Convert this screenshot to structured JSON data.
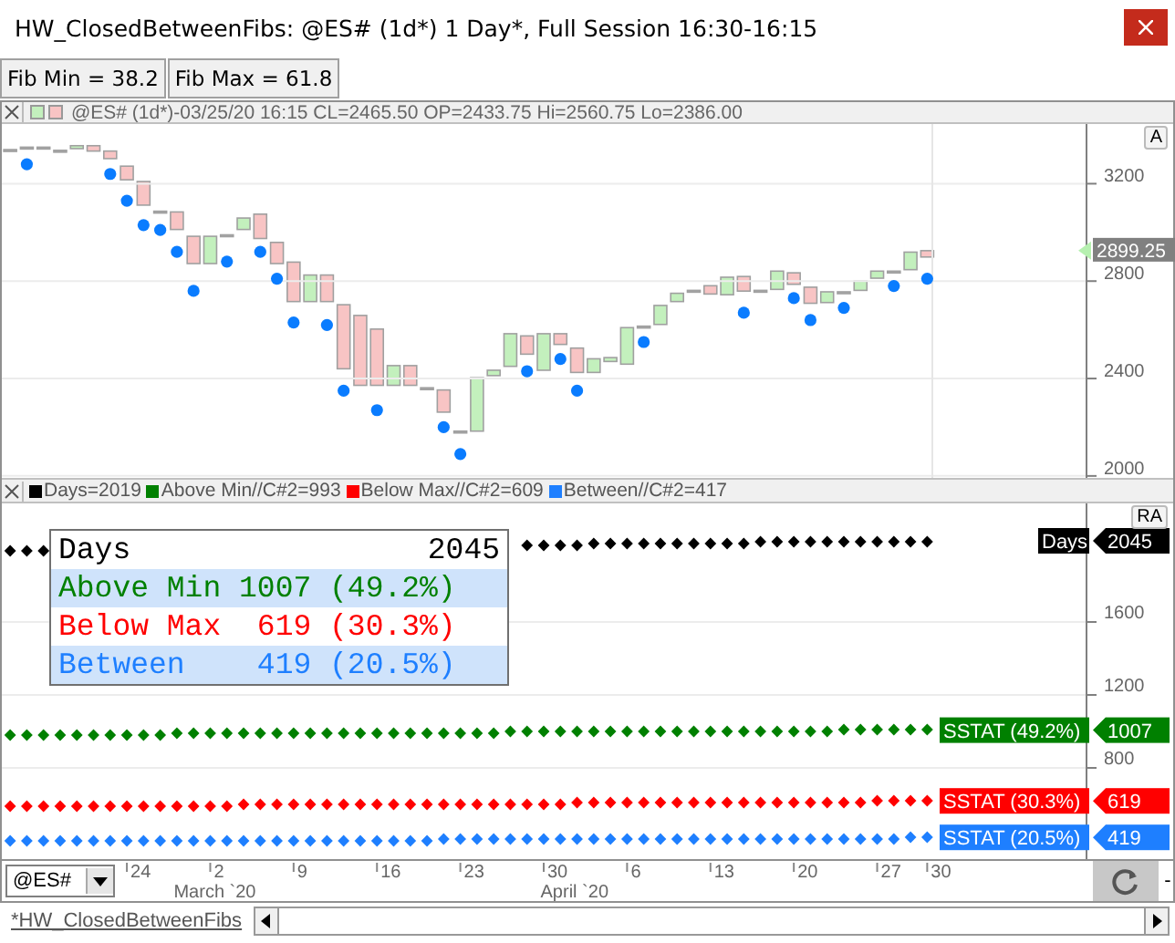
{
  "window": {
    "title": "HW_ClosedBetweenFibs: @ES# (1d*) 1 Day*, Full Session 16:30-16:15"
  },
  "inputs": [
    {
      "label": "Fib Min = 38.2"
    },
    {
      "label": "Fib Max = 61.8"
    }
  ],
  "price_pane": {
    "legend": "@ES# (1d*)-03/25/20 16:15 CL=2465.50 OP=2433.75 Hi=2560.75 Lo=2386.00",
    "scale_button": "A",
    "last_price": "2899.25",
    "chart_data": {
      "type": "scatter",
      "grid": true,
      "yticks": [
        2000,
        2400,
        2800,
        3200
      ],
      "ylim": [
        1992,
        3445
      ],
      "series": [
        {
          "color": "#0a7cff",
          "values": [
            null,
            3280,
            null,
            null,
            null,
            null,
            3240,
            3130,
            3030,
            3010,
            2920,
            2760,
            null,
            2880,
            null,
            2920,
            2810,
            2630,
            null,
            2620,
            2350,
            null,
            2270,
            null,
            null,
            null,
            2200,
            2090,
            null,
            null,
            null,
            2430,
            null,
            2480,
            2350,
            null,
            null,
            null,
            2550,
            null,
            null,
            null,
            null,
            null,
            2670,
            null,
            null,
            2730,
            2640,
            null,
            2690,
            null,
            null,
            2780,
            null,
            2810,
            null,
            null,
            null,
            null,
            null,
            null,
            null,
            null,
            null
          ]
        }
      ]
    }
  },
  "stats_pane": {
    "scale_button": "RA",
    "legend": [
      {
        "label": "Days=2019",
        "color": "#000000"
      },
      {
        "label": "Above Min//C#2=993",
        "color": "#008000"
      },
      {
        "label": "Below Max//C#2=609",
        "color": "#ff0000"
      },
      {
        "label": "Between//C#2=417",
        "color": "#1e7fff"
      }
    ],
    "table": [
      {
        "label": "Days",
        "value": "2045",
        "color": "#000000",
        "selected": false
      },
      {
        "label": "Above Min 1007 (49.2%)",
        "color": "#008000",
        "selected": true
      },
      {
        "label": "Below Max  619 (30.3%)",
        "color": "#ff0000",
        "selected": false
      },
      {
        "label": "Between    419 (20.5%)",
        "color": "#1e7fff",
        "selected": true
      }
    ],
    "value_tags": [
      {
        "label": "Days",
        "value": "2045",
        "color": "#000000"
      },
      {
        "label": "SSTAT (49.2%)",
        "value": "1007",
        "color": "#008000"
      },
      {
        "label": "SSTAT (30.3%)",
        "value": "619",
        "color": "#ff0000"
      },
      {
        "label": "SSTAT (20.5%)",
        "value": "419",
        "color": "#1e7fff"
      }
    ],
    "chart_data": {
      "type": "scatter",
      "grid": true,
      "yticks": [
        800,
        1200,
        1600
      ],
      "ylim": [
        300,
        2250
      ],
      "series": [
        {
          "color": "#000000",
          "values": [
            1990,
            1990,
            1990,
            null,
            null,
            null,
            null,
            null,
            null,
            null,
            null,
            null,
            null,
            null,
            null,
            null,
            null,
            null,
            null,
            null,
            null,
            null,
            null,
            null,
            null,
            null,
            null,
            null,
            null,
            null,
            null,
            2020,
            2020,
            2020,
            2020,
            2030,
            2030,
            2030,
            2030,
            2030,
            2030,
            2030,
            2030,
            2030,
            2030,
            2040,
            2040,
            2040,
            2040,
            2040,
            2040,
            2040,
            2040,
            2040,
            2040,
            2040,
            null,
            null,
            null,
            null,
            null,
            null,
            null,
            null,
            null
          ]
        },
        {
          "color": "#008000",
          "values": [
            980,
            980,
            980,
            980,
            980,
            980,
            980,
            980,
            980,
            980,
            990,
            990,
            990,
            990,
            990,
            990,
            990,
            990,
            990,
            990,
            990,
            990,
            990,
            990,
            990,
            990,
            990,
            990,
            990,
            990,
            1000,
            1000,
            1000,
            1000,
            1000,
            1000,
            1000,
            1000,
            1000,
            1000,
            1000,
            1000,
            1000,
            1000,
            1000,
            1000,
            1000,
            1000,
            1000,
            1000,
            1010,
            1010,
            1010,
            1010,
            1010,
            1010,
            null,
            null,
            null,
            null,
            null,
            null,
            null,
            null,
            null
          ]
        },
        {
          "color": "#ff0000",
          "values": [
            590,
            590,
            590,
            590,
            590,
            590,
            590,
            590,
            590,
            590,
            590,
            590,
            590,
            590,
            600,
            600,
            600,
            600,
            600,
            600,
            600,
            600,
            600,
            600,
            600,
            600,
            600,
            600,
            600,
            600,
            600,
            600,
            600,
            600,
            610,
            610,
            610,
            610,
            610,
            610,
            610,
            610,
            610,
            610,
            610,
            610,
            610,
            610,
            610,
            610,
            610,
            610,
            620,
            620,
            620,
            620,
            null,
            null,
            null,
            null,
            null,
            null,
            null,
            null,
            null
          ]
        },
        {
          "color": "#1e7fff",
          "values": [
            400,
            400,
            400,
            400,
            400,
            400,
            400,
            400,
            400,
            400,
            400,
            400,
            400,
            400,
            400,
            400,
            400,
            400,
            400,
            400,
            400,
            400,
            400,
            400,
            400,
            400,
            410,
            410,
            410,
            410,
            410,
            410,
            410,
            410,
            410,
            410,
            410,
            410,
            410,
            410,
            410,
            410,
            410,
            410,
            410,
            410,
            410,
            410,
            410,
            410,
            410,
            410,
            410,
            410,
            420,
            420,
            null,
            null,
            null,
            null,
            null,
            null,
            null,
            null,
            null
          ]
        }
      ]
    }
  },
  "date_axis": {
    "days": [
      "24",
      "2",
      "9",
      "16",
      "23",
      "30",
      "6",
      "13",
      "20",
      "27",
      "30"
    ],
    "months": [
      "March `20",
      "April `20"
    ]
  },
  "symbol_field": {
    "value": "@ES#"
  },
  "zoom_button": "-",
  "workspace_tab": {
    "label": "*HW_ClosedBetweenFibs"
  }
}
